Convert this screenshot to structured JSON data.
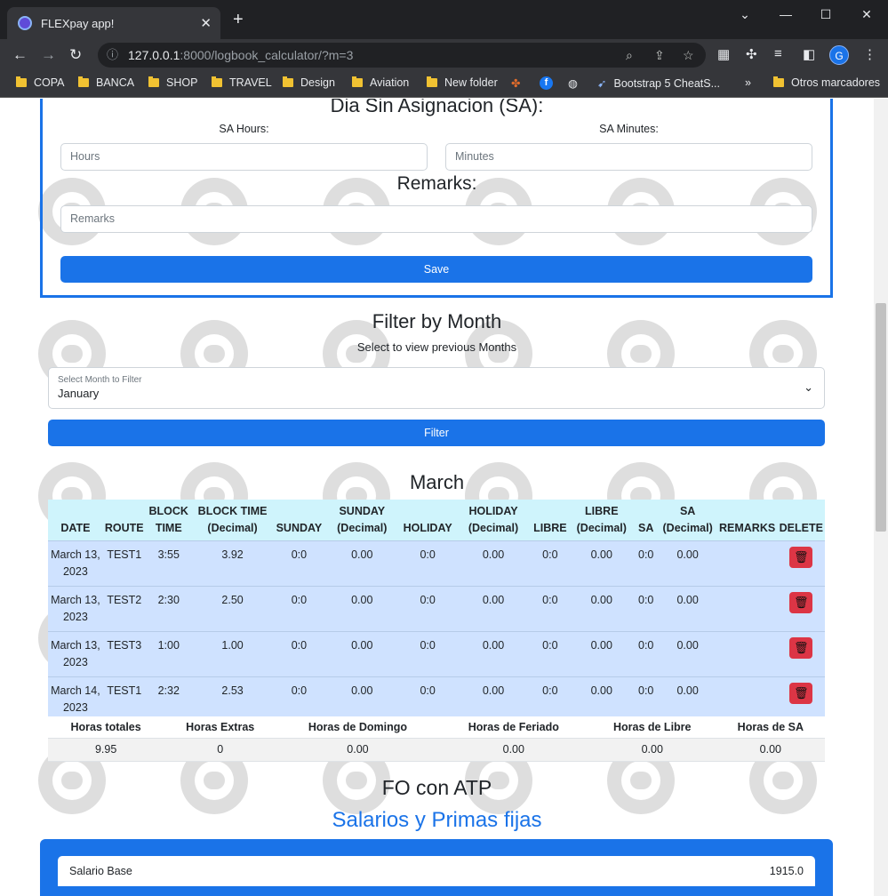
{
  "browser": {
    "tab_title": "FLEXpay app!",
    "tab_close": "✕",
    "new_tab": "+",
    "url_host": "127.0.0.1",
    "url_rest": ":8000/logbook_calculator/?m=3",
    "bookmarks": [
      "COPA",
      "BANCA",
      "SHOP",
      "TRAVEL",
      "Design",
      "Aviation",
      "New folder",
      "Bootstrap 5 CheatS...",
      "Otros marcadores"
    ],
    "bookmarks_overflow": "»",
    "profile_initial": "G"
  },
  "sa_section": {
    "title": "Dia Sin Asignacion (SA):",
    "hours_label": "SA Hours:",
    "hours_placeholder": "Hours",
    "minutes_label": "SA Minutes:",
    "minutes_placeholder": "Minutes",
    "remarks_title": "Remarks:",
    "remarks_placeholder": "Remarks",
    "save_label": "Save"
  },
  "filter": {
    "title": "Filter by Month",
    "subtitle": "Select to view previous Months",
    "select_label": "Select Month to Filter",
    "select_value": "January",
    "button_label": "Filter"
  },
  "logbook": {
    "month_title": "March",
    "headers": [
      [
        "DATE"
      ],
      [
        "ROUTE"
      ],
      [
        "BLOCK",
        "TIME"
      ],
      [
        "BLOCK TIME",
        "(Decimal)"
      ],
      [
        "SUNDAY"
      ],
      [
        "SUNDAY",
        "(Decimal)"
      ],
      [
        "HOLIDAY"
      ],
      [
        "HOLIDAY",
        "(Decimal)"
      ],
      [
        "LIBRE"
      ],
      [
        "LIBRE",
        "(Decimal)"
      ],
      [
        "SA"
      ],
      [
        "SA",
        "(Decimal)"
      ],
      [
        "REMARKS"
      ],
      [
        "DELETE"
      ]
    ],
    "rows": [
      {
        "date": "March 13, 2023",
        "route": "TEST1",
        "block": "3:55",
        "block_dec": "3.92",
        "sunday": "0:0",
        "sunday_dec": "0.00",
        "holiday": "0:0",
        "holiday_dec": "0.00",
        "libre": "0:0",
        "libre_dec": "0.00",
        "sa": "0:0",
        "sa_dec": "0.00",
        "remarks": ""
      },
      {
        "date": "March 13, 2023",
        "route": "TEST2",
        "block": "2:30",
        "block_dec": "2.50",
        "sunday": "0:0",
        "sunday_dec": "0.00",
        "holiday": "0:0",
        "holiday_dec": "0.00",
        "libre": "0:0",
        "libre_dec": "0.00",
        "sa": "0:0",
        "sa_dec": "0.00",
        "remarks": ""
      },
      {
        "date": "March 13, 2023",
        "route": "TEST3",
        "block": "1:00",
        "block_dec": "1.00",
        "sunday": "0:0",
        "sunday_dec": "0.00",
        "holiday": "0:0",
        "holiday_dec": "0.00",
        "libre": "0:0",
        "libre_dec": "0.00",
        "sa": "0:0",
        "sa_dec": "0.00",
        "remarks": ""
      },
      {
        "date": "March 14, 2023",
        "route": "TEST1",
        "block": "2:32",
        "block_dec": "2.53",
        "sunday": "0:0",
        "sunday_dec": "0.00",
        "holiday": "0:0",
        "holiday_dec": "0.00",
        "libre": "0:0",
        "libre_dec": "0.00",
        "sa": "0:0",
        "sa_dec": "0.00",
        "remarks": ""
      }
    ]
  },
  "summary": {
    "headers": [
      "Horas totales",
      "Horas Extras",
      "Horas de Domingo",
      "Horas de Feriado",
      "Horas de Libre",
      "Horas de SA"
    ],
    "values": [
      "9.95",
      "0",
      "0.00",
      "0.00",
      "0.00",
      "0.00"
    ]
  },
  "fo_title": "FO con ATP",
  "salary_title": "Salarios y Primas fijas",
  "salary": {
    "label": "Salario Base",
    "value": "1915.0"
  },
  "colors": {
    "accent": "#1a73e8",
    "table_head": "#cff4fc",
    "table_row": "#cfe2ff",
    "danger": "#dc3545"
  }
}
